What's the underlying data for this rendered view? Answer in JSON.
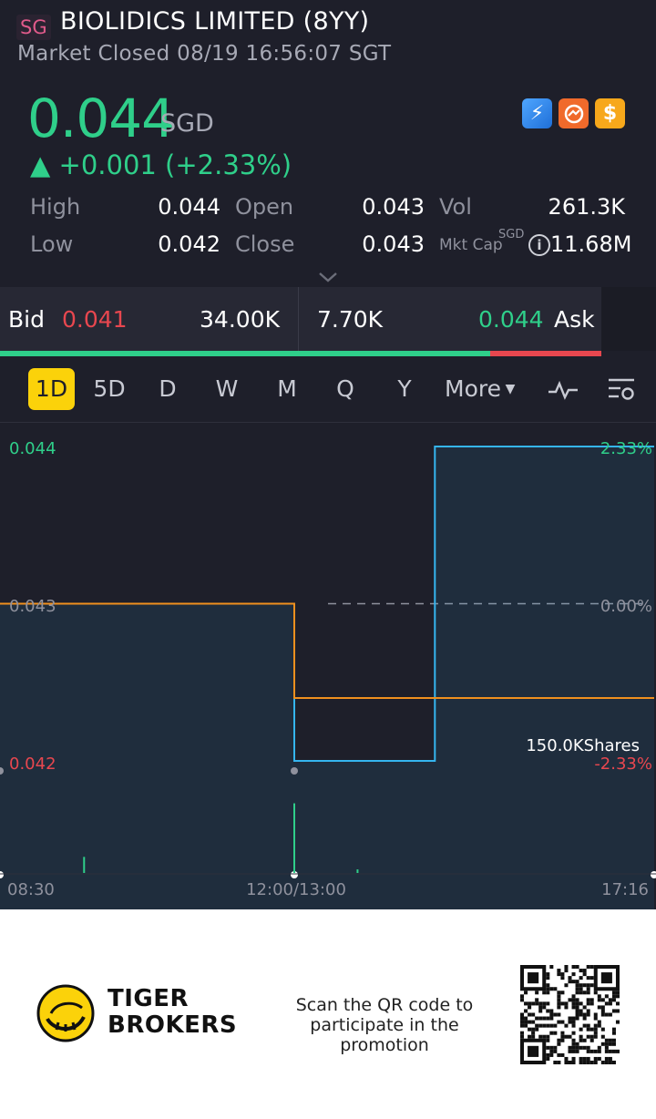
{
  "header": {
    "market_badge": "SG",
    "stock_name": "BIOLIDICS LIMITED (8YY)",
    "market_status": "Market Closed 08/19 16:56:07 SGT"
  },
  "quote": {
    "price": "0.044",
    "currency": "SGD",
    "change": "▲ +0.001 (+2.33%)"
  },
  "icons": [
    "lightning-icon",
    "card-icon",
    "dollar-icon",
    "info-icon",
    "chevron-down-icon",
    "indicator-icon",
    "settings-icon"
  ],
  "stats": {
    "high_label": "High",
    "high_value": "0.044",
    "open_label": "Open",
    "open_value": "0.043",
    "vol_label": "Vol",
    "vol_value": "261.3K",
    "low_label": "Low",
    "low_value": "0.042",
    "close_label": "Close",
    "close_value": "0.043",
    "mktcap_label": "Mkt Cap",
    "mktcap_currency": "SGD",
    "mktcap_value": "11.68M"
  },
  "bidask": {
    "bid_label": "Bid",
    "bid_price": "0.041",
    "bid_size": "34.00K",
    "ask_size": "7.70K",
    "ask_price": "0.044",
    "ask_label": "Ask",
    "bid_ratio": 0.815
  },
  "periods": [
    {
      "label": "1D",
      "active": true
    },
    {
      "label": "5D",
      "active": false
    },
    {
      "label": "D",
      "active": false
    },
    {
      "label": "W",
      "active": false
    },
    {
      "label": "M",
      "active": false
    },
    {
      "label": "Q",
      "active": false
    },
    {
      "label": "Y",
      "active": false
    },
    {
      "label": "More",
      "active": false
    }
  ],
  "colors": {
    "up": "#2fcf8a",
    "down": "#e8474f",
    "price_line": "#35b5ef",
    "avg_line": "#f0901e",
    "active_tab": "#fbd20a"
  },
  "chart_data": {
    "type": "line",
    "title": "",
    "y_labels_left": [
      "0.044",
      "0.043",
      "0.042"
    ],
    "y_labels_right": [
      "2.33%",
      "0.00%",
      "-2.33%"
    ],
    "x_labels": [
      "08:30",
      "12:00/13:00",
      "17:16"
    ],
    "ylim": [
      0.042,
      0.044
    ],
    "prev_close": 0.043,
    "volume_tooltip": "150.0KShares",
    "series": [
      {
        "name": "price",
        "points": [
          [
            "08:30",
            0.043
          ],
          [
            "12:10",
            0.043
          ],
          [
            "12:10",
            0.042
          ],
          [
            "14:40",
            0.042
          ],
          [
            "14:40",
            0.044
          ],
          [
            "17:16",
            0.044
          ]
        ]
      },
      {
        "name": "average",
        "points": [
          [
            "08:30",
            0.043
          ],
          [
            "12:10",
            0.043
          ],
          [
            "12:12",
            0.0425
          ],
          [
            "12:15",
            0.0424
          ],
          [
            "17:16",
            0.0424
          ]
        ]
      }
    ],
    "volume_bars": [
      {
        "time": "09:30",
        "volume": 18,
        "dir": "up"
      },
      {
        "time": "13:45",
        "volume": 4,
        "dir": "up"
      },
      {
        "time": "12:10",
        "volume": 25,
        "dir": "down"
      },
      {
        "time": "12:15",
        "volume": 78,
        "dir": "up"
      }
    ]
  },
  "footer": {
    "brand_line1": "TIGER",
    "brand_line2": "BROKERS",
    "promo_text": "Scan the QR code to participate in the promotion"
  }
}
